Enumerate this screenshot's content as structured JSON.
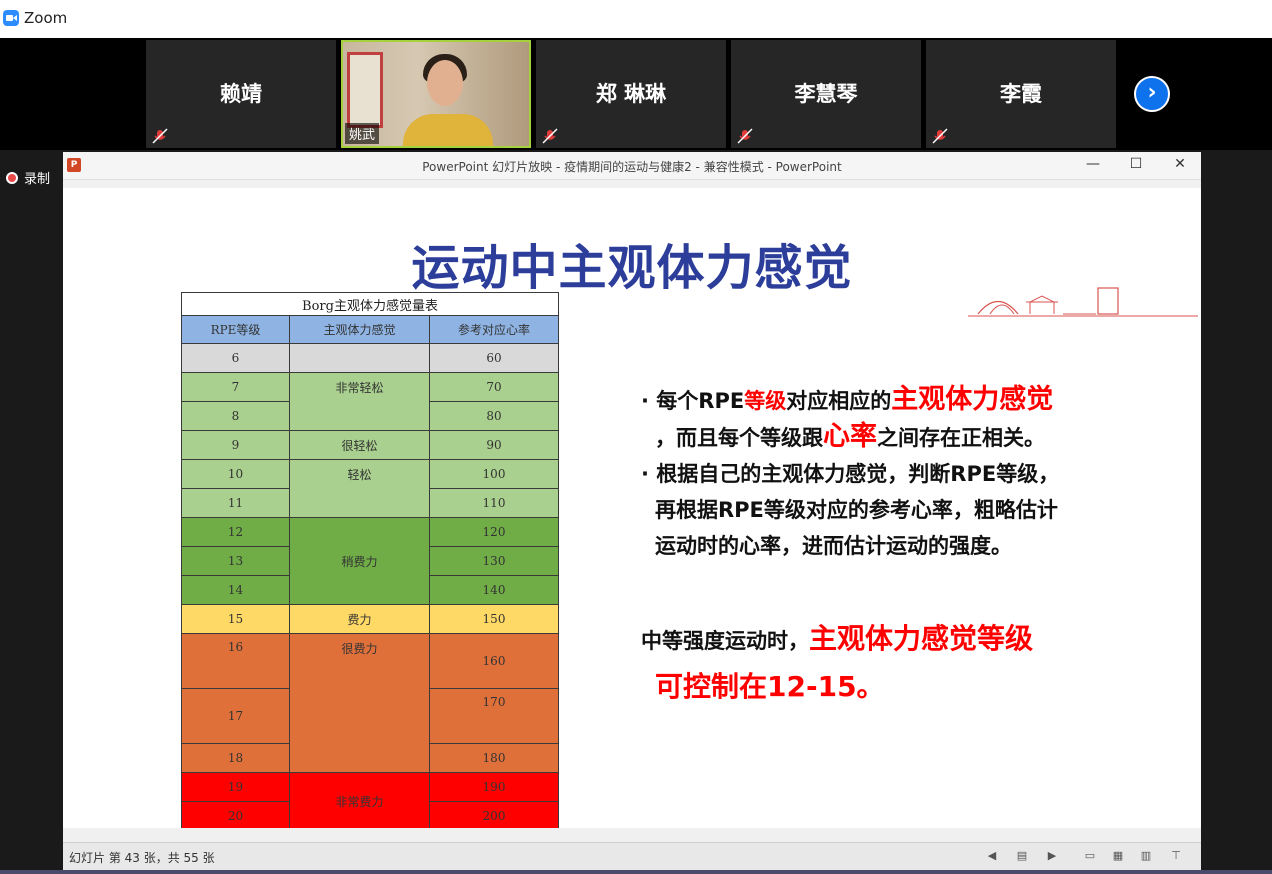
{
  "zoom": {
    "title": "Zoom",
    "record_label": "录制"
  },
  "participants": [
    {
      "name": "赖靖",
      "muted": true
    },
    {
      "name": "姚武",
      "video": true,
      "muted": false
    },
    {
      "name": "郑 琳琳",
      "muted": true
    },
    {
      "name": "李慧琴",
      "muted": true
    },
    {
      "name": "李霞",
      "muted": true
    }
  ],
  "ppt": {
    "window_title": "PowerPoint 幻灯片放映 - 疫情期间的运动与健康2 - 兼容性模式 - PowerPoint",
    "app_icon_letter": "P",
    "status_text": "幻灯片 第 43 张，共 55 张"
  },
  "slide": {
    "title": "运动中主观体力感觉",
    "table": {
      "caption": "Borg主观体力感觉量表",
      "headers": [
        "RPE等级",
        "主观体力感觉",
        "参考对应心率"
      ],
      "rpe": [
        "6",
        "7",
        "8",
        "9",
        "10",
        "11",
        "12",
        "13",
        "14",
        "15",
        "16",
        "17",
        "18",
        "19",
        "20"
      ],
      "feelings": [
        "非常轻松",
        "很轻松",
        "轻松",
        "稍费力",
        "费力",
        "很费力",
        "非常费力"
      ],
      "hr": [
        "60",
        "70",
        "80",
        "90",
        "100",
        "110",
        "120",
        "130",
        "140",
        "150",
        "160",
        "170",
        "180",
        "190",
        "200"
      ]
    },
    "bullets": {
      "b1_a": "每个RPE",
      "b1_b": "等级",
      "b1_c": "对应相应的",
      "b1_d": "主观体力感觉",
      "b1_e": "，而且每个等级跟",
      "b1_f": "心率",
      "b1_g": "之间存在正相关。",
      "b2_a": "根据自己的主观体力感觉，判断RPE等级，",
      "b2_b": "再根据RPE等级对应的参考心率，粗略估计",
      "b2_c": "运动时的心率，进而估计运动的强度。"
    },
    "conclusion": {
      "a": "中等强度运动时，",
      "b": "主观体力感觉等级",
      "c": "可控制在12-15。"
    }
  }
}
